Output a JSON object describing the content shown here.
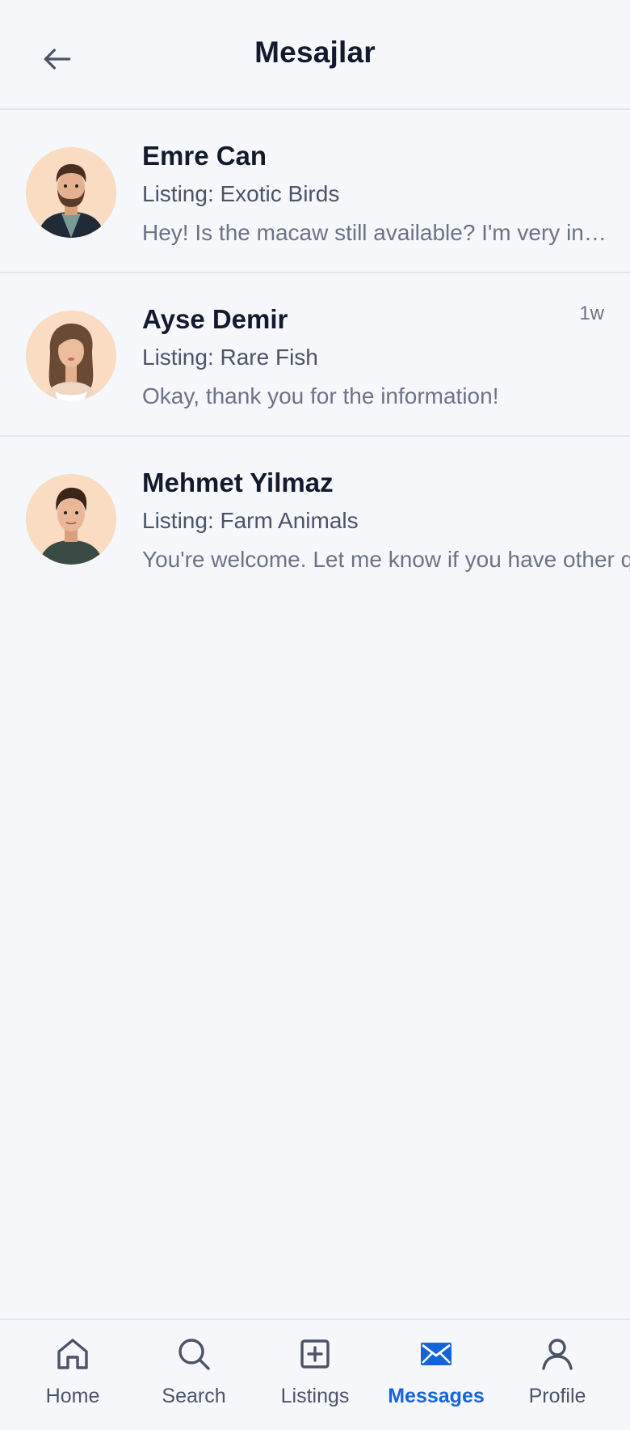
{
  "header": {
    "title": "Mesajlar",
    "back_icon": "arrow-left-icon"
  },
  "conversations": [
    {
      "name": "Emre Can",
      "listing": "Listing: Exotic Birds",
      "preview": "Hey! Is the macaw still available? I'm very interested",
      "time": "",
      "avatar_icon": "avatar-man-beard"
    },
    {
      "name": "Ayse Demir",
      "listing": "Listing: Rare Fish",
      "preview": "Okay, thank you for the information!",
      "time": "1w",
      "avatar_icon": "avatar-woman"
    },
    {
      "name": "Mehmet Yilmaz",
      "listing": "Listing: Farm Animals",
      "preview": "You're welcome. Let me know if you have other questions.",
      "time": "",
      "avatar_icon": "avatar-man"
    }
  ],
  "bottom_nav": {
    "items": [
      {
        "label": "Home",
        "icon": "home-icon",
        "active": false
      },
      {
        "label": "Search",
        "icon": "search-icon",
        "active": false
      },
      {
        "label": "Listings",
        "icon": "plus-square-icon",
        "active": false
      },
      {
        "label": "Messages",
        "icon": "mail-icon",
        "active": true
      },
      {
        "label": "Profile",
        "icon": "user-icon",
        "active": false
      }
    ]
  },
  "colors": {
    "background": "#f5f7fa",
    "accent": "#1565d8",
    "text_primary": "#141a2e",
    "text_secondary": "#6b7385",
    "divider": "#e3e6eb"
  }
}
